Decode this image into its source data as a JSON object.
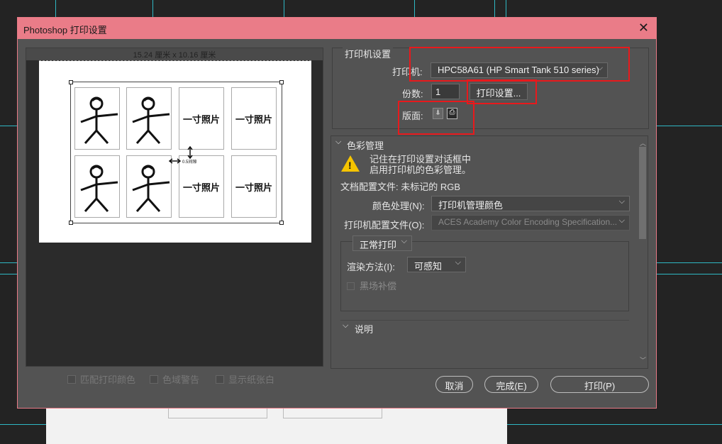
{
  "dialog": {
    "title": "Photoshop 打印设置",
    "close": "✕"
  },
  "preview": {
    "paper_size": "15.24 厘米 x 10.16 厘米",
    "photo_label": "一寸照片",
    "gap_label": "0.5间隙"
  },
  "preview_options": [
    {
      "label": "匹配打印颜色",
      "checked": false
    },
    {
      "label": "色域警告",
      "checked": false
    },
    {
      "label": "显示纸张白",
      "checked": false
    }
  ],
  "printer_setup": {
    "section_title": "打印机设置",
    "printer_label": "打印机:",
    "printer_value": "HPC58A61 (HP Smart Tank 510 series)",
    "copies_label": "份数:",
    "copies_value": "1",
    "print_settings_button": "打印设置...",
    "layout_label": "版面:"
  },
  "color_management": {
    "section_title": "色彩管理",
    "warning_line1": "记住在打印设置对话框中",
    "warning_line2": "启用打印机的色彩管理。",
    "doc_profile": "文档配置文件: 未标记的 RGB",
    "color_handling_label": "颜色处理(N):",
    "color_handling_value": "打印机管理颜色",
    "printer_profile_label": "打印机配置文件(O):",
    "printer_profile_value": "ACES Academy Color Encoding Specification...",
    "normal_print": "正常打印",
    "render_label": "渲染方法(I):",
    "render_value": "可感知",
    "black_point": "黑场补偿"
  },
  "description": {
    "section_title": "说明"
  },
  "footer": {
    "cancel": "取消",
    "done": "完成(E)",
    "print": "打印(P)"
  },
  "colors": {
    "title_bar": "#ea7c88",
    "highlight_box": "#e8191c",
    "guides": "#2fb8c4"
  }
}
